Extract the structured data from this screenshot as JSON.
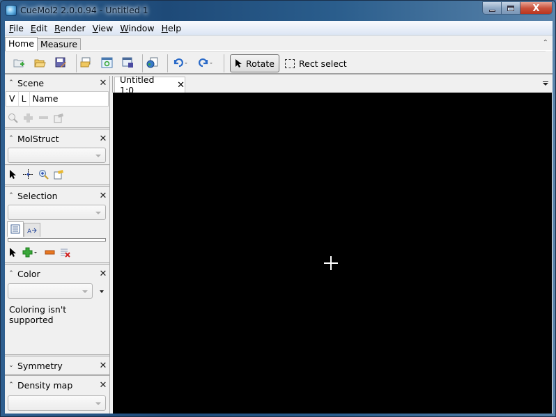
{
  "window": {
    "title": "CueMol2 2.0.0.94 - Untitled 1",
    "controls": {
      "minimize": "minimize",
      "maximize": "maximize",
      "close": "X"
    }
  },
  "menubar": {
    "items": [
      {
        "label": "File",
        "mnemonic": "F",
        "rest": "ile"
      },
      {
        "label": "Edit",
        "mnemonic": "E",
        "rest": "dit"
      },
      {
        "label": "Render",
        "mnemonic": "R",
        "rest": "ender"
      },
      {
        "label": "View",
        "mnemonic": "V",
        "rest": "iew"
      },
      {
        "label": "Window",
        "mnemonic": "W",
        "rest": "indow"
      },
      {
        "label": "Help",
        "mnemonic": "H",
        "rest": "elp"
      }
    ]
  },
  "ribbon": {
    "tabs": [
      {
        "label": "Home",
        "active": true
      },
      {
        "label": "Measure",
        "active": false
      }
    ],
    "collapse_glyph": "^"
  },
  "toolbar": {
    "icons": [
      {
        "name": "new-file-icon",
        "group": 1
      },
      {
        "name": "open-folder-icon",
        "group": 1
      },
      {
        "name": "save-icon",
        "group": 1
      },
      {
        "name": "open-scene-icon",
        "group": 2
      },
      {
        "name": "refresh-view-icon",
        "group": 2
      },
      {
        "name": "save-scene-icon",
        "group": 2
      },
      {
        "name": "web-document-icon",
        "group": 3
      },
      {
        "name": "undo-icon",
        "group": 4
      },
      {
        "name": "redo-icon",
        "group": 4
      }
    ],
    "rotate_label": "Rotate",
    "rect_select_label": "Rect select"
  },
  "panels": {
    "scene": {
      "title": "Scene",
      "columns": [
        "V",
        "L",
        "Name"
      ],
      "tools": [
        "zoom-in-icon",
        "add-icon",
        "remove-icon",
        "properties-icon"
      ]
    },
    "molstruct": {
      "title": "MolStruct",
      "combo_value": "",
      "tools": [
        "pointer-icon",
        "center-icon",
        "zoom-icon",
        "properties-icon"
      ]
    },
    "selection": {
      "title": "Selection",
      "combo_value": "",
      "tabs": [
        "list-view-icon",
        "text-edit-icon"
      ],
      "tools": [
        "pointer-icon",
        "add-selection-icon",
        "remove-selection-icon",
        "clear-selection-icon"
      ]
    },
    "color": {
      "title": "Color",
      "combo_value": "",
      "message": "Coloring isn't supported"
    },
    "symmetry": {
      "title": "Symmetry",
      "collapsed": true
    },
    "density_map": {
      "title": "Density map",
      "combo_value": ""
    }
  },
  "document": {
    "tab_label": "Untitled 1:0",
    "viewport_background": "#000000"
  },
  "colors": {
    "titlebar": "#2a5d8c",
    "viewport": "#000000",
    "crosshair": "#ffffff"
  }
}
